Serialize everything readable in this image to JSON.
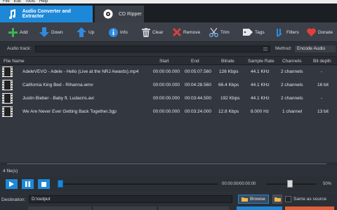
{
  "menu": [
    "File",
    "Edit",
    "Tools",
    "Help"
  ],
  "tabs": [
    {
      "label": "Audio Converter and Extractor",
      "icon": "music-note-icon"
    },
    {
      "label": "CD Ripper",
      "icon": "cd-icon"
    }
  ],
  "toolbar": {
    "add": "Add",
    "down": "Down",
    "up": "Up",
    "info": "Info",
    "clear": "Clear",
    "remove": "Remove",
    "trim": "Trim",
    "tags": "Tags",
    "filters": "Filters",
    "donate": "Donate"
  },
  "track": {
    "label": "Audio track:",
    "method_label": "Method:",
    "method_value": "Encode Audio"
  },
  "columns": {
    "file_name": "File Name",
    "start": "Start",
    "end": "End",
    "bitrate": "Bitrate",
    "sample_rate": "Sample Rate",
    "channels": "Channels",
    "bit_depth": "Bit depth"
  },
  "files": [
    {
      "name": "AdeleVEVO - Adele - Hello (Live at the NRJ Awards).mp4",
      "start": "00:00:00.000",
      "end": "00:05:07.560",
      "bitrate": "126 Kbps",
      "sample_rate": "44.1 KHz",
      "channels": "2 channels",
      "bit_depth": "-"
    },
    {
      "name": "California King Bed - Rihanna.wmv",
      "start": "00:00:00.000",
      "end": "00:04:28.560",
      "bitrate": "66.4 Kbps",
      "sample_rate": "44.1 KHz",
      "channels": "2 channels",
      "bit_depth": "16 bit"
    },
    {
      "name": "Justin Bieber - Baby ft. Ludacris.avi",
      "start": "00:00:00.000",
      "end": "00:03:44.500",
      "bitrate": "192 Kbps",
      "sample_rate": "44.1 KHz",
      "channels": "2 channels",
      "bit_depth": "-"
    },
    {
      "name": "We Are Never Ever Getting Back Together.3gp",
      "start": "00:00:00.000",
      "end": "00:03:24.000",
      "bitrate": "12.8 Kbps",
      "sample_rate": "8.000 Hz",
      "channels": "1 channel",
      "bit_depth": "13 bit"
    }
  ],
  "status": {
    "file_count": "4 file(s)"
  },
  "player": {
    "time": "00:00:00/00:00:00",
    "volume": "50%",
    "volume_level": 0.5,
    "seek_level": 0
  },
  "destination": {
    "label": "Destination:",
    "path": "D:\\output",
    "browse": "Browse",
    "same_as_source": "Same as source"
  },
  "colors": {
    "accent": "#1e88d8",
    "background": "#2d3139",
    "toolbar": "#3b4049"
  }
}
